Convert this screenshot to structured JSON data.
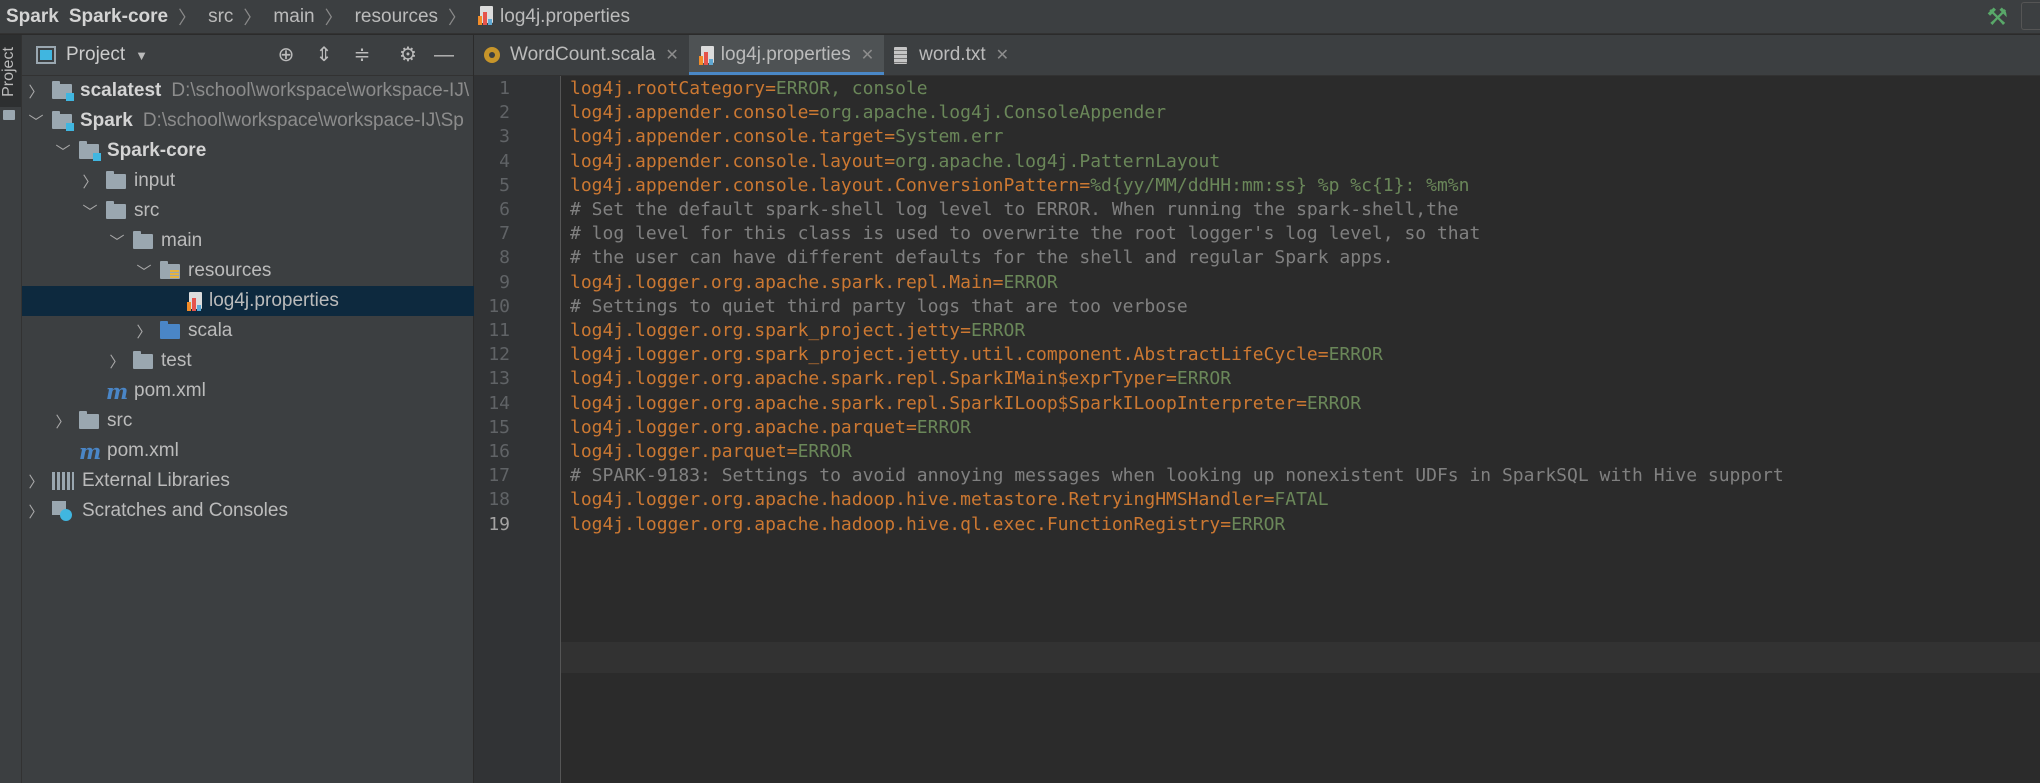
{
  "breadcrumb": {
    "items": [
      "Spark",
      "Spark-core",
      "src",
      "main",
      "resources",
      "log4j.properties"
    ]
  },
  "project_panel": {
    "tab_label": "Project",
    "title": "Project",
    "tree": [
      {
        "label": "scalatest",
        "path": "D:\\school\\workspace\\workspace-IJ\\"
      },
      {
        "label": "Spark",
        "path": "D:\\school\\workspace\\workspace-IJ\\Sp"
      },
      {
        "label": "Spark-core"
      },
      {
        "label": "input"
      },
      {
        "label": "src"
      },
      {
        "label": "main"
      },
      {
        "label": "resources"
      },
      {
        "label": "log4j.properties"
      },
      {
        "label": "scala"
      },
      {
        "label": "test"
      },
      {
        "label": "pom.xml"
      },
      {
        "label": "src"
      },
      {
        "label": "pom.xml"
      },
      {
        "label": "External Libraries"
      },
      {
        "label": "Scratches and Consoles"
      }
    ]
  },
  "tabs": [
    {
      "label": "WordCount.scala",
      "icon": "scala-file-icon"
    },
    {
      "label": "log4j.properties",
      "icon": "properties-file-icon"
    },
    {
      "label": "word.txt",
      "icon": "text-file-icon"
    }
  ],
  "editor": {
    "current_line": 19,
    "lines": [
      {
        "n": "1",
        "key": "log4j.rootCategory",
        "value": "ERROR, console"
      },
      {
        "n": "2",
        "key": "log4j.appender.console",
        "value": "org.apache.log4j.ConsoleAppender"
      },
      {
        "n": "3",
        "key": "log4j.appender.console.target",
        "value": "System.err"
      },
      {
        "n": "4",
        "key": "log4j.appender.console.layout",
        "value": "org.apache.log4j.PatternLayout"
      },
      {
        "n": "5",
        "key": "log4j.appender.console.layout.ConversionPattern",
        "value": "%d{yy/MM/ddHH:mm:ss} %p %c{1}: %m%n"
      },
      {
        "n": "6",
        "comment": "# Set the default spark-shell log level to ERROR. When running the spark-shell,the"
      },
      {
        "n": "7",
        "comment": "# log level for this class is used to overwrite the root logger's log level, so that"
      },
      {
        "n": "8",
        "comment": "# the user can have different defaults for the shell and regular Spark apps."
      },
      {
        "n": "9",
        "key": "log4j.logger.org.apache.spark.repl.Main",
        "value": "ERROR"
      },
      {
        "n": "10",
        "comment": "# Settings to quiet third party logs that are too verbose"
      },
      {
        "n": "11",
        "key": "log4j.logger.org.spark_project.jetty",
        "value": "ERROR"
      },
      {
        "n": "12",
        "key": "log4j.logger.org.spark_project.jetty.util.component.AbstractLifeCycle",
        "value": "ERROR"
      },
      {
        "n": "13",
        "key": "log4j.logger.org.apache.spark.repl.SparkIMain$exprTyper",
        "value": "ERROR"
      },
      {
        "n": "14",
        "key": "log4j.logger.org.apache.spark.repl.SparkILoop$SparkILoopInterpreter",
        "value": "ERROR"
      },
      {
        "n": "15",
        "key": "log4j.logger.org.apache.parquet",
        "value": "ERROR"
      },
      {
        "n": "16",
        "key": "log4j.logger.parquet",
        "value": "ERROR"
      },
      {
        "n": "17",
        "comment": "# SPARK-9183: Settings to avoid annoying messages when looking up nonexistent UDFs in SparkSQL with Hive support"
      },
      {
        "n": "18",
        "key": "log4j.logger.org.apache.hadoop.hive.metastore.RetryingHMSHandler",
        "value": "FATAL"
      },
      {
        "n": "19",
        "key": "log4j.logger.org.apache.hadoop.hive.ql.exec.FunctionRegistry",
        "value": "ERROR"
      }
    ]
  },
  "colors": {
    "key": "#cc7832",
    "value": "#6a8759",
    "comment": "#808080",
    "selection": "#0d293e",
    "active_tab_underline": "#4a88c7"
  }
}
